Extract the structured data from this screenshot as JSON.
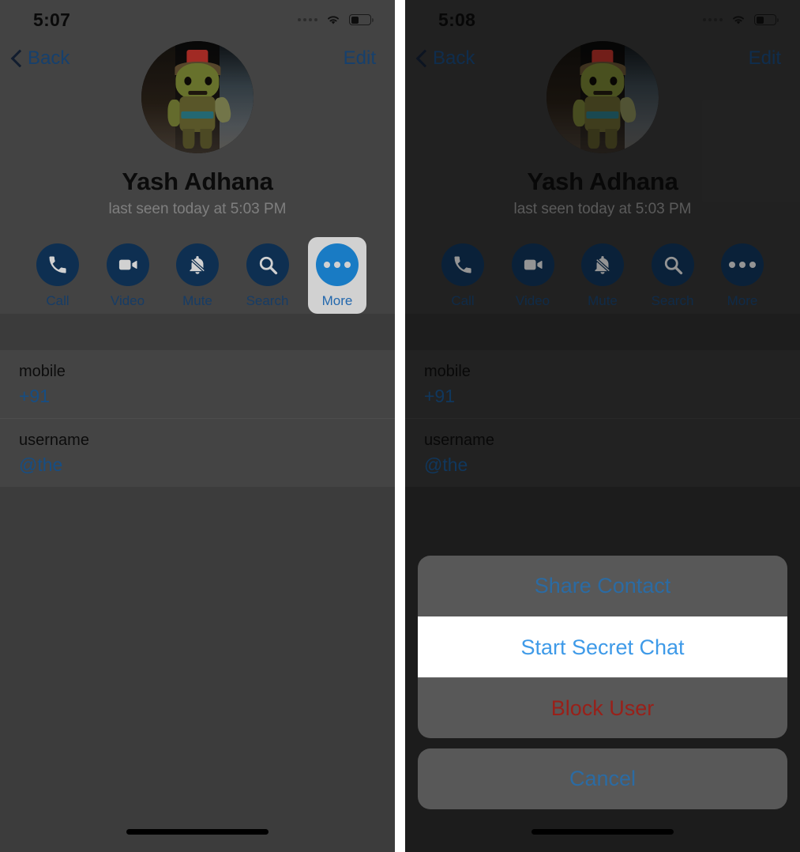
{
  "panels": [
    {
      "id": "left",
      "status": {
        "time": "5:07",
        "wifi_icon": "wifi-icon",
        "battery_icon": "battery-icon",
        "signal_icon": "signal-dots-icon"
      },
      "nav": {
        "back_label": "Back",
        "back_icon": "chevron-left-icon",
        "edit_label": "Edit"
      },
      "profile": {
        "name": "Yash Adhana",
        "status_text": "last seen today at 5:03 PM",
        "avatar_name": "contact-avatar"
      },
      "actions": [
        {
          "label": "Call",
          "icon": "phone-icon",
          "highlighted": false
        },
        {
          "label": "Video",
          "icon": "video-camera-icon",
          "highlighted": false
        },
        {
          "label": "Mute",
          "icon": "bell-slash-icon",
          "highlighted": false
        },
        {
          "label": "Search",
          "icon": "search-icon",
          "highlighted": false
        },
        {
          "label": "More",
          "icon": "ellipsis-icon",
          "highlighted": true
        }
      ],
      "info_rows": [
        {
          "label": "mobile",
          "value": "+91"
        },
        {
          "label": "username",
          "value": "@the"
        }
      ],
      "sheet_visible": false
    },
    {
      "id": "right",
      "status": {
        "time": "5:08",
        "wifi_icon": "wifi-icon",
        "battery_icon": "battery-icon",
        "signal_icon": "signal-dots-icon"
      },
      "nav": {
        "back_label": "Back",
        "back_icon": "chevron-left-icon",
        "edit_label": "Edit"
      },
      "profile": {
        "name": "Yash Adhana",
        "status_text": "last seen today at 5:03 PM",
        "avatar_name": "contact-avatar"
      },
      "actions": [
        {
          "label": "Call",
          "icon": "phone-icon",
          "highlighted": false
        },
        {
          "label": "Video",
          "icon": "video-camera-icon",
          "highlighted": false
        },
        {
          "label": "Mute",
          "icon": "bell-slash-icon",
          "highlighted": false
        },
        {
          "label": "Search",
          "icon": "search-icon",
          "highlighted": false
        },
        {
          "label": "More",
          "icon": "ellipsis-icon",
          "highlighted": false
        }
      ],
      "info_rows": [
        {
          "label": "mobile",
          "value": "+91"
        },
        {
          "label": "username",
          "value": "@the"
        }
      ],
      "sheet_visible": true,
      "sheet": {
        "items": [
          {
            "label": "Share Contact",
            "style": "default",
            "highlighted": false
          },
          {
            "label": "Start Secret Chat",
            "style": "default",
            "highlighted": true
          },
          {
            "label": "Block User",
            "style": "destructive",
            "highlighted": false
          }
        ],
        "cancel_label": "Cancel"
      }
    }
  ],
  "colors": {
    "accent_blue": "#1b4f86",
    "highlight_blue": "#3e9ae8",
    "button_circle": "#123a63",
    "button_circle_active": "#1f97f0",
    "destructive_red": "#992019",
    "sheet_bg": "#585858"
  }
}
